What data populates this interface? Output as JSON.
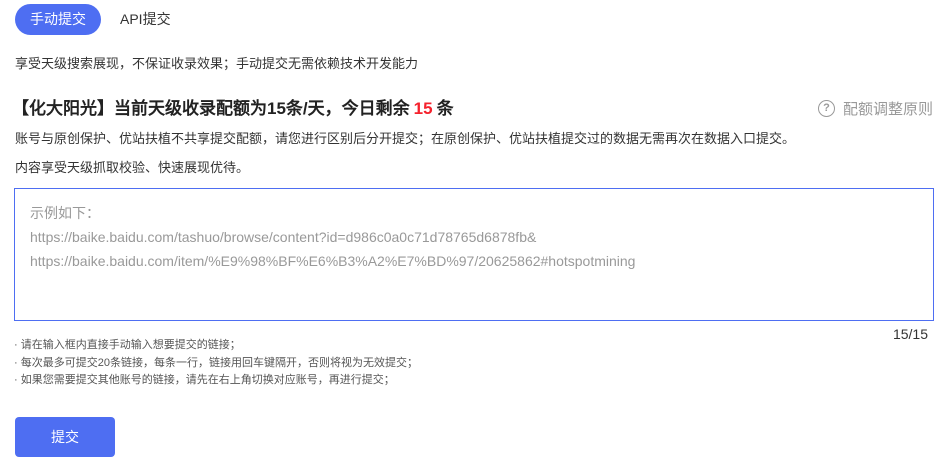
{
  "tabs": [
    {
      "label": "手动提交",
      "active": true
    },
    {
      "label": "API提交",
      "active": false
    }
  ],
  "description": "享受天级搜索展现，不保证收录效果；手动提交无需依赖技术开发能力",
  "quota": {
    "prefix": "【化大阳光】当前天级收录配额为15条/天，今日剩余",
    "remaining": "15",
    "suffix": "条"
  },
  "rules_link": {
    "icon": "question-circle-icon",
    "label": "配额调整原则"
  },
  "notes": [
    "账号与原创保护、优站扶植不共享提交配额，请您进行区别后分开提交；在原创保护、优站扶植提交过的数据无需再次在数据入口提交。",
    "内容享受天级抓取校验、快速展现优待。"
  ],
  "textarea": {
    "placeholder_lines": [
      "示例如下：",
      "https://baike.baidu.com/tashuo/browse/content?id=d986c0a0c71d78765d6878fb&",
      "https://baike.baidu.com/item/%E9%98%BF%E6%B3%A2%E7%BD%97/20625862#hotspotmining"
    ]
  },
  "counter": "15/15",
  "tips": [
    "· 请在输入框内直接手动输入想要提交的链接；",
    "· 每次最多可提交20条链接，每条一行，链接用回车键隔开，否则将视为无效提交；",
    "· 如果您需要提交其他账号的链接，请先在右上角切换对应账号，再进行提交；"
  ],
  "submit_label": "提交",
  "colors": {
    "accent": "#4e6ef2",
    "remaining": "#f5222d"
  }
}
